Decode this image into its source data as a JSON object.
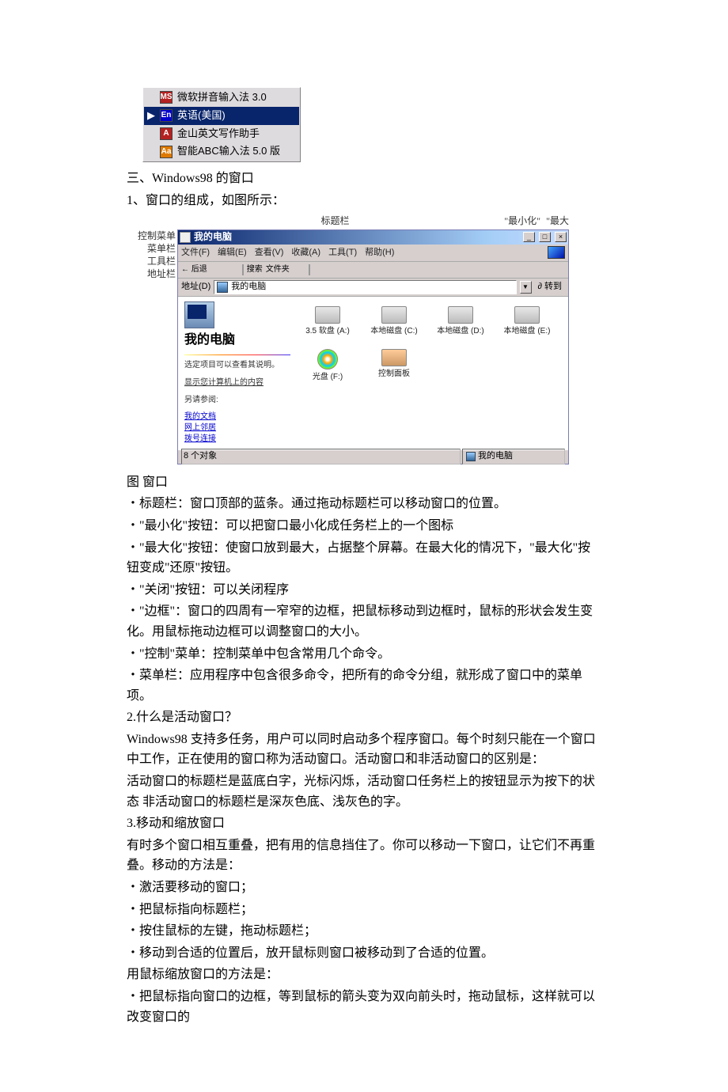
{
  "ime": {
    "items": [
      {
        "icon": "ic-ms",
        "abbr": "MS",
        "label": "微软拼音输入法 3.0",
        "selected": false
      },
      {
        "icon": "ic-en",
        "abbr": "En",
        "label": "英语(美国)",
        "selected": true
      },
      {
        "icon": "ic-js",
        "abbr": "A",
        "label": "金山英文写作助手",
        "selected": false
      },
      {
        "icon": "ic-abc",
        "abbr": "Aa",
        "label": "智能ABC输入法 5.0 版",
        "selected": false
      }
    ]
  },
  "text": {
    "heading3": "三、Windows98 的窗口",
    "p1": "1、窗口的组成，如图所示：",
    "top_labels": {
      "title": "标题栏",
      "min": "\"最小化\"",
      "max": "\"最大",
      "close_hint": ""
    },
    "left_labels": {
      "ctrl": "控制菜单",
      "menu": "菜单栏",
      "tool": "工具栏",
      "addr": "地址栏"
    },
    "caption": "图 窗口",
    "bullets1": [
      "・标题栏：窗口顶部的蓝条。通过拖动标题栏可以移动窗口的位置。",
      "・\"最小化\"按钮：可以把窗口最小化成任务栏上的一个图标",
      "・\"最大化\"按钮：使窗口放到最大，占据整个屏幕。在最大化的情况下，\"最大化\"按钮变成\"还原\"按钮。",
      "・\"关闭\"按钮：可以关闭程序",
      "・\"边框\"：窗口的四周有一窄窄的边框，把鼠标移动到边框时，鼠标的形状会发生变化。用鼠标拖动边框可以调整窗口的大小。",
      "・\"控制\"菜单：控制菜单中包含常用几个命令。",
      "・菜单栏：应用程序中包含很多命令，把所有的命令分组，就形成了窗口中的菜单项。"
    ],
    "q2": "2.什么是活动窗口？",
    "q2_body": [
      "Windows98 支持多任务，用户可以同时启动多个程序窗口。每个时刻只能在一个窗口中工作，正在使用的窗口称为活动窗口。活动窗口和非活动窗口的区别是：",
      "活动窗口的标题栏是蓝底白字，光标闪烁，活动窗口任务栏上的按钮显示为按下的状态 非活动窗口的标题栏是深灰色底、浅灰色的字。"
    ],
    "q3": "3.移动和缩放窗口",
    "q3_intro": "有时多个窗口相互重叠，把有用的信息挡住了。你可以移动一下窗口，让它们不再重叠。移动的方法是：",
    "q3_steps": [
      "・激活要移动的窗口；",
      "・把鼠标指向标题栏；",
      "・按住鼠标的左键，拖动标题栏；",
      "・移动到合适的位置后，放开鼠标则窗口被移动到了合适的位置。"
    ],
    "q3_resize": "用鼠标缩放窗口的方法是：",
    "q3_resize1": "・把鼠标指向窗口的边框，等到鼠标的箭头变为双向前头时，拖动鼠标，这样就可以改变窗口的"
  },
  "win": {
    "title": "我的电脑",
    "menus": [
      "文件(F)",
      "编辑(E)",
      "查看(V)",
      "收藏(A)",
      "工具(T)",
      "帮助(H)"
    ],
    "toolbar_labels": [
      "后退",
      "",
      "",
      "搜索",
      "文件夹",
      "",
      "",
      "",
      "",
      ""
    ],
    "addr_label": "地址(D)",
    "addr_value": "我的电脑",
    "go": "转到",
    "left": {
      "title": "我的电脑",
      "hint": "选定项目可以查看其说明。",
      "sub": "显示您计算机上的内容",
      "see": "另请参阅:",
      "links": [
        "我的文档",
        "网上邻居",
        "拨号连接"
      ]
    },
    "drives": [
      {
        "label": "3.5 软盘 (A:)",
        "cls": ""
      },
      {
        "label": "本地磁盘 (C:)",
        "cls": ""
      },
      {
        "label": "本地磁盘 (D:)",
        "cls": ""
      },
      {
        "label": "本地磁盘 (E:)",
        "cls": ""
      },
      {
        "label": "光盘 (F:)",
        "cls": "cd"
      },
      {
        "label": "控制面板",
        "cls": "cp"
      }
    ],
    "status_left": "8 个对象",
    "status_right": "我的电脑"
  }
}
